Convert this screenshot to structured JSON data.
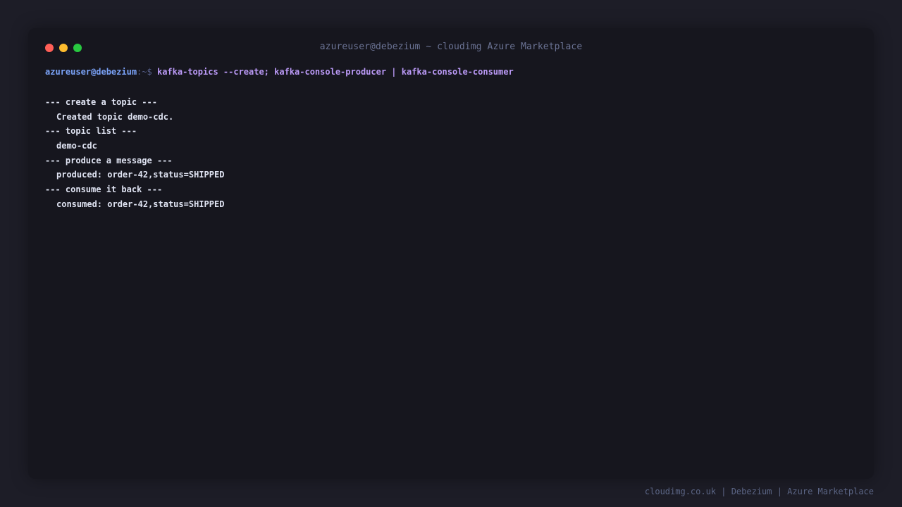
{
  "window": {
    "title": "azureuser@debezium ~ cloudimg Azure Marketplace",
    "controls": [
      {
        "name": "close-button",
        "color": "#ff5f57"
      },
      {
        "name": "minimize-button",
        "color": "#febc2e"
      },
      {
        "name": "maximize-button",
        "color": "#28c840"
      }
    ]
  },
  "prompt": {
    "user_host": "azureuser@debezium",
    "path": ":~$",
    "command": "kafka-topics --create; kafka-console-producer | kafka-console-consumer"
  },
  "output": [
    {
      "text": "--- create a topic ---",
      "indent": false
    },
    {
      "text": "Created topic demo-cdc.",
      "indent": true
    },
    {
      "text": "--- topic list ---",
      "indent": false
    },
    {
      "text": "demo-cdc",
      "indent": true
    },
    {
      "text": "--- produce a message ---",
      "indent": false
    },
    {
      "text": "produced: order-42,status=SHIPPED",
      "indent": true
    },
    {
      "text": "--- consume it back ---",
      "indent": false
    },
    {
      "text": "consumed: order-42,status=SHIPPED",
      "indent": true
    }
  ],
  "footer": "cloudimg.co.uk | Debezium | Azure Marketplace",
  "colors": {
    "background": "#1d1d27",
    "terminal": "#16161e",
    "user_host": "#7aa2f7",
    "command": "#bb9af7",
    "output_text": "#dfe3f2"
  }
}
